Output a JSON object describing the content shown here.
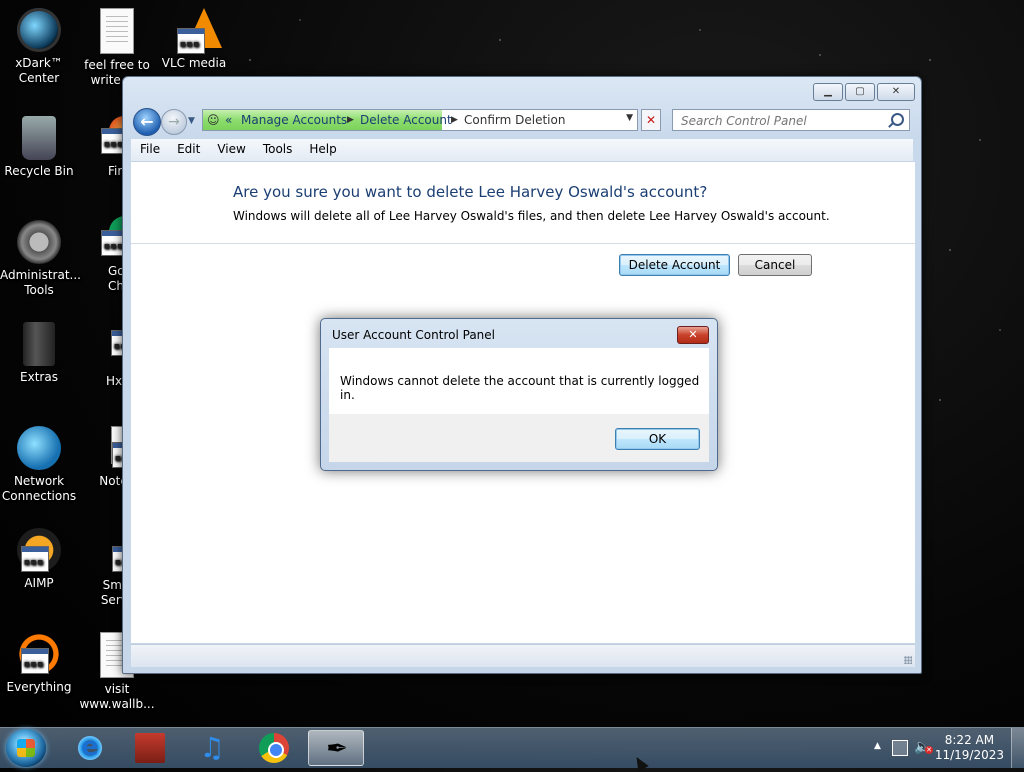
{
  "desktop": {
    "icons": [
      {
        "label": "xDark™ Center"
      },
      {
        "label": "feel free to write a..."
      },
      {
        "label": "VLC media"
      },
      {
        "label": "Recycle Bin"
      },
      {
        "label": "Firef"
      },
      {
        "label": "Administrat... Tools"
      },
      {
        "label": "Goog Chro"
      },
      {
        "label": "Extras"
      },
      {
        "label": "Hxl"
      },
      {
        "label": "Network Connections"
      },
      {
        "label": "Notepa"
      },
      {
        "label": "AIMP"
      },
      {
        "label": "Sma Servi"
      },
      {
        "label": "Everything"
      },
      {
        "label": "visit www.wallb..."
      }
    ]
  },
  "window": {
    "breadcrumbs": [
      "Manage Accounts",
      "Delete Account",
      "Confirm Deletion"
    ],
    "breadcrumb_prefix": "«",
    "search_placeholder": "Search Control Panel",
    "menu": [
      "File",
      "Edit",
      "View",
      "Tools",
      "Help"
    ],
    "question": "Are you sure you want to delete Lee Harvey Oswald's account?",
    "description": "Windows will delete all of Lee Harvey Oswald's files, and then delete Lee Harvey Oswald's account.",
    "delete_button": "Delete Account",
    "cancel_button": "Cancel"
  },
  "dialog": {
    "title": "User Account Control Panel",
    "message": "Windows cannot delete the account that is currently logged in.",
    "ok_button": "OK"
  },
  "taskbar": {
    "pinned": [
      "Internet Explorer",
      "Media app",
      "Music player",
      "Google Chrome",
      "Ink app"
    ],
    "time": "8:22 AM",
    "date": "11/19/2023"
  }
}
